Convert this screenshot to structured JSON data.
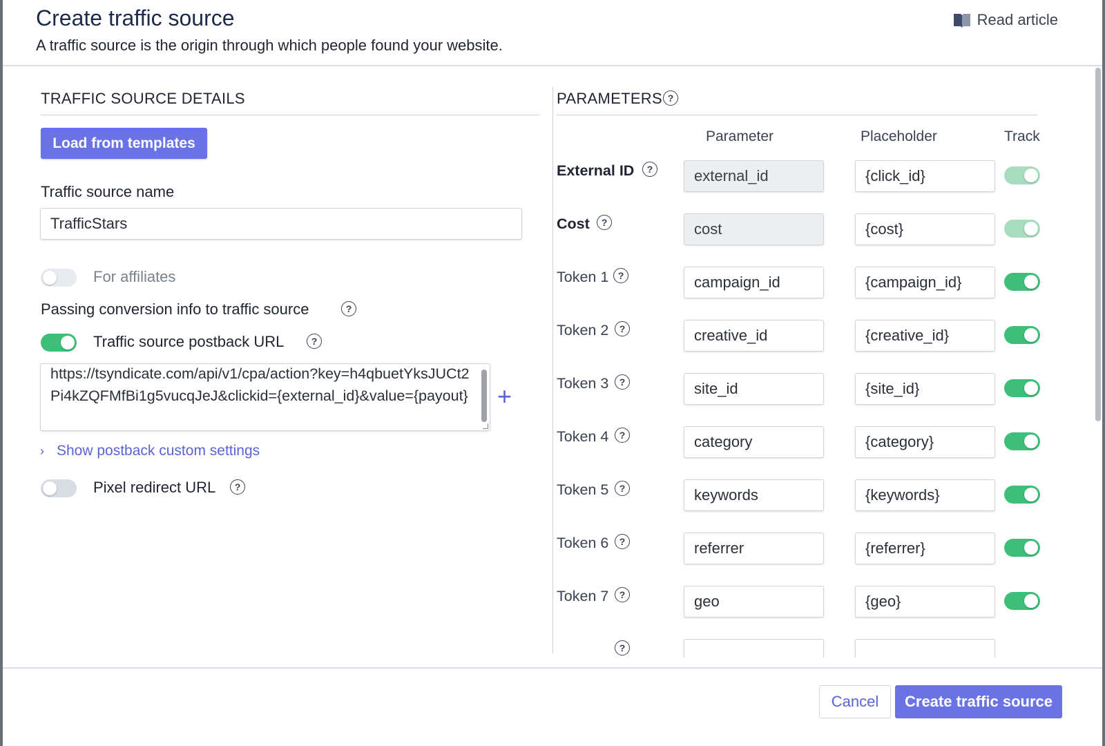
{
  "header": {
    "title": "Create traffic source",
    "subtitle": "A traffic source is the origin through which people found your website.",
    "read_article": "Read article"
  },
  "details": {
    "section_title": "TRAFFIC SOURCE DETAILS",
    "load_templates": "Load from templates",
    "name_label": "Traffic source name",
    "name_value": "TrafficStars",
    "for_affiliates_label": "For affiliates",
    "passing_info_label": "Passing conversion info to traffic source",
    "postback_label": "Traffic source postback URL",
    "postback_url": "https://tsyndicate.com/api/v1/cpa/action?key=h4qbuetYksJUCt2Pi4kZQFMfBi1g5vucqJeJ&clickid={external_id}&value={payout}",
    "show_custom_settings": "Show postback custom settings",
    "pixel_redirect_label": "Pixel redirect URL"
  },
  "parameters": {
    "section_title": "PARAMETERS",
    "col_parameter": "Parameter",
    "col_placeholder": "Placeholder",
    "col_track": "Track",
    "rows": [
      {
        "label": "External ID",
        "parameter": "external_id",
        "placeholder": "{click_id}"
      },
      {
        "label": "Cost",
        "parameter": "cost",
        "placeholder": "{cost}"
      },
      {
        "label": "Token 1",
        "parameter": "campaign_id",
        "placeholder": "{campaign_id}"
      },
      {
        "label": "Token 2",
        "parameter": "creative_id",
        "placeholder": "{creative_id}"
      },
      {
        "label": "Token 3",
        "parameter": "site_id",
        "placeholder": "{site_id}"
      },
      {
        "label": "Token 4",
        "parameter": "category",
        "placeholder": "{category}"
      },
      {
        "label": "Token 5",
        "parameter": "keywords",
        "placeholder": "{keywords}"
      },
      {
        "label": "Token 6",
        "parameter": "referrer",
        "placeholder": "{referrer}"
      },
      {
        "label": "Token 7",
        "parameter": "geo",
        "placeholder": "{geo}"
      }
    ]
  },
  "footer": {
    "cancel": "Cancel",
    "create": "Create traffic source"
  },
  "colors": {
    "accent": "#6a73e6",
    "toggle_on": "#3dbf7a",
    "link": "#5a63d6"
  }
}
